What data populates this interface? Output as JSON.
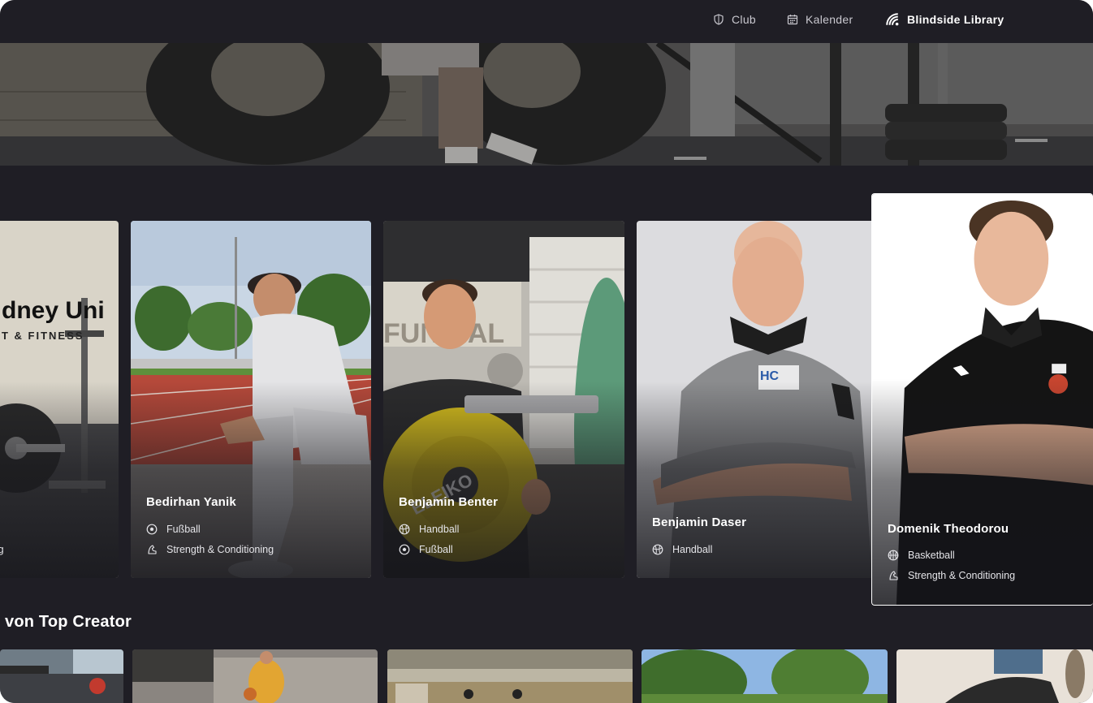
{
  "nav": {
    "items": [
      {
        "label": "Club",
        "icon": "shield-icon"
      },
      {
        "label": "Kalender",
        "icon": "calendar-icon"
      },
      {
        "label": "Blindside Library",
        "icon": "library-icon",
        "active": true
      }
    ]
  },
  "creators": [
    {
      "name": "",
      "tags": [
        {
          "label": "oning",
          "icon": "strength-icon"
        }
      ]
    },
    {
      "name": "Bedirhan Yanik",
      "tags": [
        {
          "label": "Fußball",
          "icon": "football-icon"
        },
        {
          "label": "Strength & Conditioning",
          "icon": "strength-icon"
        }
      ]
    },
    {
      "name": "Benjamin Benter",
      "tags": [
        {
          "label": "Handball",
          "icon": "handball-icon"
        },
        {
          "label": "Fußball",
          "icon": "football-icon"
        }
      ]
    },
    {
      "name": "Benjamin Daser",
      "tags": [
        {
          "label": "Handball",
          "icon": "handball-icon"
        }
      ]
    },
    {
      "name": "Domenik Theodorou",
      "tags": [
        {
          "label": "Basketball",
          "icon": "basketball-icon"
        },
        {
          "label": "Strength & Conditioning",
          "icon": "strength-icon"
        }
      ]
    }
  ],
  "gym_sign": {
    "line1": "dney Uni",
    "line2": "T & FITNESS"
  },
  "section": {
    "title": "von Top Creator"
  },
  "colors": {
    "background": "#1f1e25",
    "text": "#ffffff",
    "muted_text": "#c9c8cf"
  }
}
